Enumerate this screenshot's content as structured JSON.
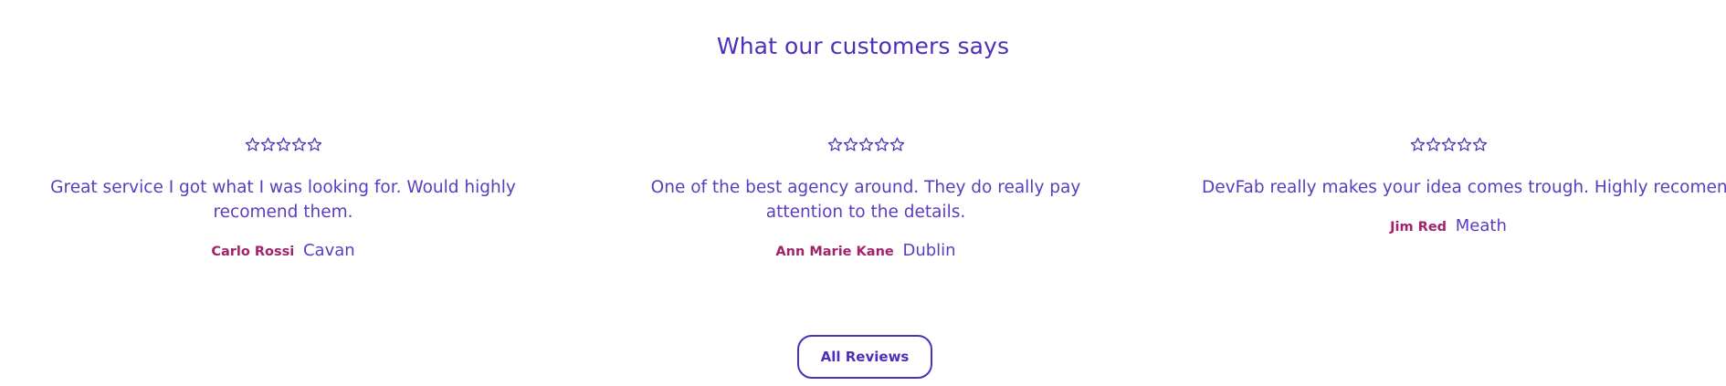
{
  "section": {
    "title": "What our customers says"
  },
  "reviews": [
    {
      "rating": 0,
      "max_rating": 5,
      "text": "Great service I got what I was looking for. Would highly recomend them.",
      "name": "Carlo Rossi",
      "location": "Cavan"
    },
    {
      "rating": 0,
      "max_rating": 5,
      "text": "One of the best agency around. They do really pay attention to the details.",
      "name": "Ann Marie Kane",
      "location": "Dublin"
    },
    {
      "rating": 0,
      "max_rating": 5,
      "text": "DevFab really makes your idea comes trough. Highly recomend.",
      "name": "Jim Red",
      "location": "Meath"
    }
  ],
  "cta": {
    "label": "All Reviews"
  },
  "colors": {
    "primary": "#4d2fb8",
    "text": "#5a3dbf",
    "name_accent": "#a2236c",
    "background": "#ffffff"
  }
}
